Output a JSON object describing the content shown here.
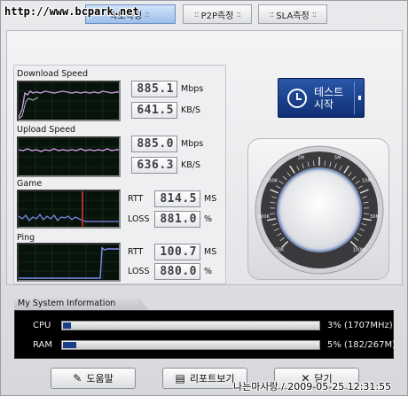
{
  "watermark_top": "http://www.bcpark.net",
  "tabs": [
    {
      "label": "속도측정",
      "active": true
    },
    {
      "label": "P2P측정",
      "active": false
    },
    {
      "label": "SLA측정",
      "active": false
    }
  ],
  "download": {
    "label": "Download Speed",
    "value1": "885.1",
    "unit1": "Mbps",
    "value2": "641.5",
    "unit2": "KB/S"
  },
  "upload": {
    "label": "Upload Speed",
    "value1": "885.0",
    "unit1": "Mbps",
    "value2": "636.3",
    "unit2": "KB/S"
  },
  "game": {
    "label": "Game",
    "rtt_label": "RTT",
    "rtt_value": "814.5",
    "rtt_unit": "MS",
    "loss_label": "LOSS",
    "loss_value": "881.0",
    "loss_unit": "%"
  },
  "ping": {
    "label": "Ping",
    "rtt_label": "RTT",
    "rtt_value": "100.7",
    "rtt_unit": "MS",
    "loss_label": "LOSS",
    "loss_value": "880.0",
    "loss_unit": "%"
  },
  "start_button": {
    "label_line1": "테스트",
    "label_line2": "시작"
  },
  "gauge": {
    "tick_labels": [
      "50K",
      "100K",
      "500K",
      "1M",
      "5M",
      "10M",
      "50M",
      "100M"
    ]
  },
  "system_info": {
    "title": "My System Information",
    "cpu": {
      "label": "CPU",
      "percent": 3,
      "value": "3% (1707MHz)"
    },
    "ram": {
      "label": "RAM",
      "percent": 5,
      "value": "5% (182/267M)"
    }
  },
  "buttons": {
    "help": "도움말",
    "report": "리포트보기",
    "close": "닫기"
  },
  "watermark_bottom": "나는마사랑 / 2009-05-25 12:31:55",
  "colors": {
    "accent": "#1b3f86",
    "graph_bg": "#06120a",
    "download_line": "#c69ad6",
    "upload_line": "#d0a0e6",
    "game_line": "#7f8df0",
    "ping_line": "#7f8df0",
    "marker_red": "#e0302a"
  }
}
